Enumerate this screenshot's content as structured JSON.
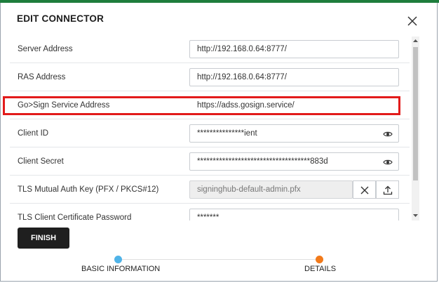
{
  "dialog": {
    "title": "EDIT CONNECTOR",
    "close_icon": "close-icon"
  },
  "form": {
    "rows": [
      {
        "label": "Server Address",
        "value": "http://192.168.0.64:8777/"
      },
      {
        "label": "RAS Address",
        "value": "http://192.168.0.64:8777/"
      },
      {
        "label": "Go>Sign Service Address",
        "value": "https://adss.gosign.service/"
      },
      {
        "label": "Client ID",
        "value": "***************ient",
        "icon": "eye-icon"
      },
      {
        "label": "Client Secret",
        "value": "************************************883d",
        "icon": "eye-icon"
      },
      {
        "label": "TLS Mutual Auth Key (PFX / PKCS#12)",
        "value": "signinghub-default-admin.pfx",
        "actions": [
          "clear-icon",
          "upload-icon"
        ]
      },
      {
        "label": "TLS Client Certificate Password",
        "value": "*******"
      }
    ]
  },
  "footer": {
    "finish_label": "FINISH"
  },
  "stepper": {
    "steps": [
      {
        "label": "BASIC INFORMATION",
        "color": "#4fb3e8"
      },
      {
        "label": "DETAILS",
        "color": "#f27a1a"
      }
    ]
  },
  "colors": {
    "highlight": "#e21b1b",
    "topbar": "#1e7d3c",
    "button": "#1f1f1f"
  }
}
